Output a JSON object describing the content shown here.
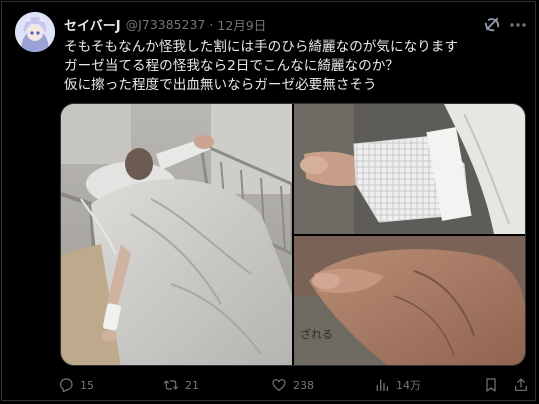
{
  "tweet": {
    "display_name": "セイバーJ",
    "handle": "@J73385237",
    "separator": "·",
    "date": "12月9日",
    "text_lines": [
      "そもそもなんか怪我した割には手のひら綺麗なのが気になります",
      "ガーゼ当てる程の怪我なら2日でこんなに綺麗なのか？",
      "仮に擦った程度で出血無いならガーゼ必要無さそう"
    ],
    "media": [
      {
        "icon": "photo-patient-in-bed"
      },
      {
        "icon": "photo-gauze-on-hand"
      },
      {
        "icon": "photo-palm-closeup",
        "partial_text": "ざれる"
      }
    ]
  },
  "actions": {
    "reply_count": "15",
    "retweet_count": "21",
    "like_count": "238",
    "view_count": "14万"
  },
  "colors": {
    "background": "#000000",
    "text": "#e7e9ea",
    "muted": "#71767b",
    "border": "#2f3336"
  }
}
